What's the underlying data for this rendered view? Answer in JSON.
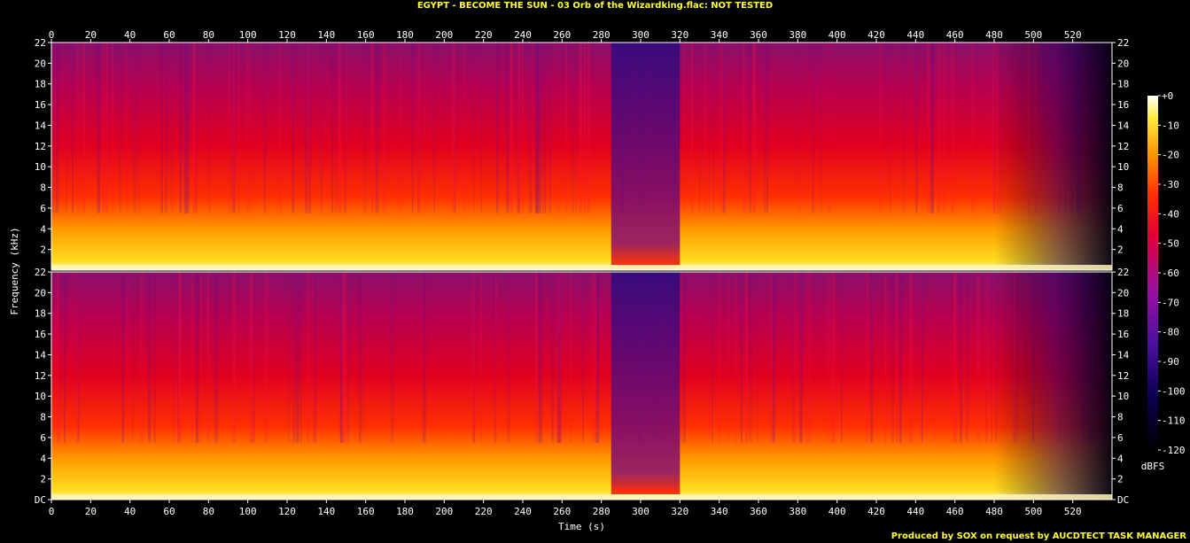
{
  "title": "EGYPT - BECOME THE SUN - 03 Orb of the Wizardking.flac: NOT TESTED",
  "credit": "Produced by SOX on request by AUCDTECT TASK MANAGER",
  "chart_data": {
    "type": "heatmap",
    "subtype": "spectrogram",
    "channels": 2,
    "xlabel": "Time (s)",
    "ylabel": "Frequency (kHz)",
    "xlim": [
      0,
      540
    ],
    "ylim": [
      0,
      22
    ],
    "x_ticks": [
      0,
      20,
      40,
      60,
      80,
      100,
      120,
      140,
      160,
      180,
      200,
      220,
      240,
      260,
      280,
      300,
      320,
      340,
      360,
      380,
      400,
      420,
      440,
      460,
      480,
      500,
      520
    ],
    "y_tick_labels": [
      "DC",
      "2",
      "4",
      "6",
      "8",
      "10",
      "12",
      "14",
      "16",
      "18",
      "20",
      "22"
    ],
    "colorbar": {
      "label": "dBFS",
      "ticks": [
        "+0",
        "-10",
        "-20",
        "-30",
        "-40",
        "-50",
        "-60",
        "-70",
        "-80",
        "-90",
        "-100",
        "-110",
        "-120"
      ],
      "range": [
        -120,
        0
      ]
    },
    "features": [
      {
        "description": "quiet dip / low energy region",
        "x_range": [
          285,
          320
        ]
      },
      {
        "description": "fade out",
        "x_range": [
          480,
          540
        ]
      }
    ]
  },
  "colors": {
    "title": "#ffff33",
    "axis": "#ffffff",
    "background": "#000000"
  }
}
